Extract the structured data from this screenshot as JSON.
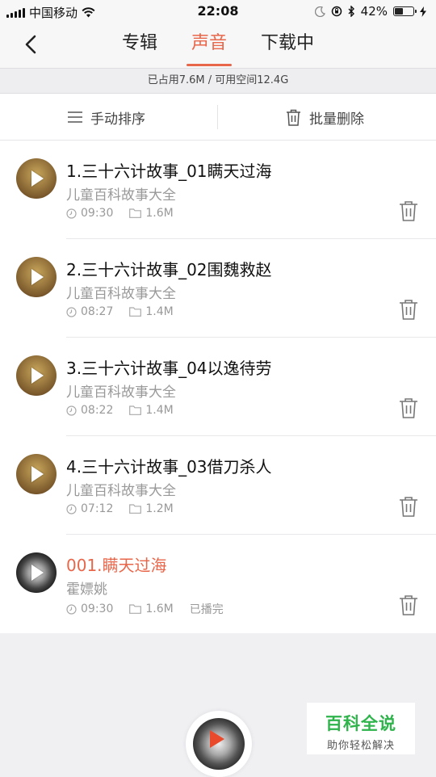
{
  "status": {
    "carrier": "中国移动",
    "time": "22:08",
    "battery": "42%",
    "battery_level": 0.42
  },
  "nav": {
    "tabs": [
      {
        "label": "专辑",
        "active": false
      },
      {
        "label": "声音",
        "active": true
      },
      {
        "label": "下载中",
        "active": false
      }
    ]
  },
  "storage": "已占用7.6M / 可用空间12.4G",
  "toolbar": {
    "sort_label": "手动排序",
    "delete_label": "批量删除"
  },
  "items": [
    {
      "title": "1.三十六计故事_01瞒天过海",
      "subtitle": "儿童百科故事大全",
      "duration": "09:30",
      "size": "1.6M",
      "status": "",
      "highlight": false
    },
    {
      "title": "2.三十六计故事_02围魏救赵",
      "subtitle": "儿童百科故事大全",
      "duration": "08:27",
      "size": "1.4M",
      "status": "",
      "highlight": false
    },
    {
      "title": "3.三十六计故事_04以逸待劳",
      "subtitle": "儿童百科故事大全",
      "duration": "08:22",
      "size": "1.4M",
      "status": "",
      "highlight": false
    },
    {
      "title": "4.三十六计故事_03借刀杀人",
      "subtitle": "儿童百科故事大全",
      "duration": "07:12",
      "size": "1.2M",
      "status": "",
      "highlight": false
    },
    {
      "title": "001.瞒天过海",
      "subtitle": "霍嫖姚",
      "duration": "09:30",
      "size": "1.6M",
      "status": "已播完",
      "highlight": true
    }
  ],
  "watermark": {
    "title": "百科全说",
    "subtitle": "助你轻松解决"
  },
  "colors": {
    "accent": "#e8674a",
    "watermark_green": "#2fb34b"
  }
}
